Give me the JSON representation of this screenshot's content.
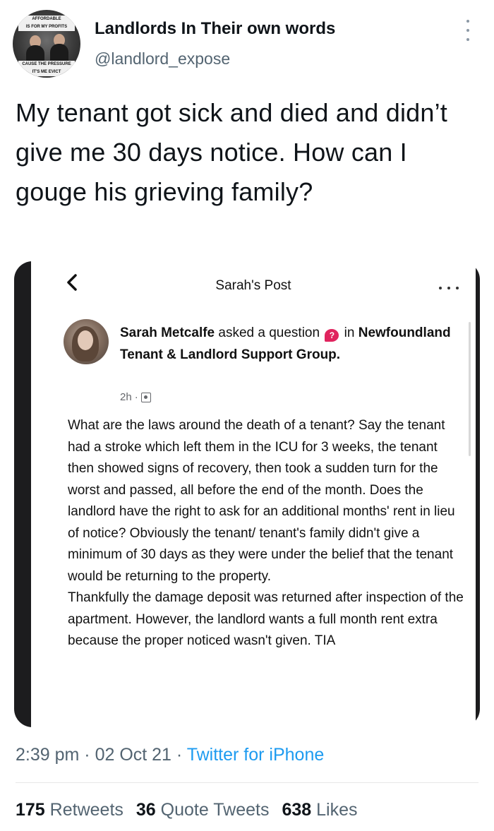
{
  "account": {
    "display_name": "Landlords In Their own words",
    "handle": "@landlord_expose",
    "avatar_text_top": "AFFORDABLE",
    "avatar_text_top2": "IS FOR MY PROFITS",
    "avatar_text_bottom": "CAUSE THE PRESSURE",
    "avatar_text_bottom2": "IT'S ME EVICT"
  },
  "tweet": {
    "text": "My tenant got sick and died and didn’t give me 30 days notice. How can I gouge his grieving family?"
  },
  "embedded_post": {
    "nav_title": "Sarah's Post",
    "author": "Sarah Metcalfe",
    "action": "asked a question",
    "question_icon": "?",
    "preposition": "in",
    "group": "Newfoundland Tenant & Landlord Support Group.",
    "time": "2h",
    "separator": "·",
    "body_paragraph_1": "What are the laws around the death of a tenant? Say the tenant had a stroke which left them in the ICU for 3 weeks, the tenant then showed signs of recovery, then took a sudden turn for the worst and passed, all before the end of the month. Does the landlord have the right to ask for an additional months' rent in lieu of notice? Obviously the tenant/ tenant's family didn't give a minimum of 30 days as they were under the belief that the tenant would be returning to the property.",
    "body_paragraph_2": "Thankfully the damage deposit was returned after inspection of the apartment. However, the landlord wants a full month rent extra because the proper noticed wasn't given. TIA"
  },
  "meta": {
    "time": "2:39 pm",
    "sep1": " · ",
    "date": "02 Oct 21",
    "sep2": " · ",
    "source": "Twitter for iPhone"
  },
  "stats": {
    "retweets_count": "175",
    "retweets_label": "Retweets",
    "quotes_count": "36",
    "quotes_label": "Quote Tweets",
    "likes_count": "638",
    "likes_label": "Likes"
  },
  "colors": {
    "link": "#1d9bf0",
    "secondary_text": "#536471",
    "embed_frame": "#1c1c1e"
  }
}
